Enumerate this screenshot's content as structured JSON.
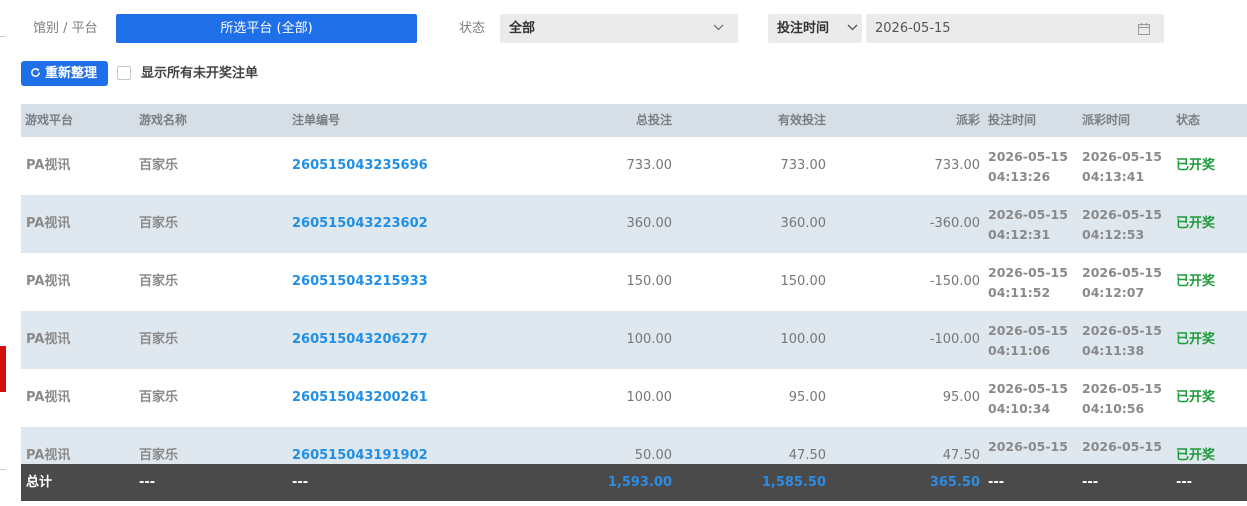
{
  "filters": {
    "platform_label": "馆别 / 平台",
    "platform_button": "所选平台 (全部)",
    "status_label": "状态",
    "status_value": "全部",
    "time_type_value": "投注时间",
    "date_value": "2026-05-15"
  },
  "actions": {
    "refresh_label": "重新整理",
    "show_unsettled_label": "显示所有未开奖注单",
    "show_unsettled_checked": false
  },
  "table": {
    "headers": {
      "platform": "游戏平台",
      "game": "游戏名称",
      "bet_id": "注单编号",
      "total_bet": "总投注",
      "valid_bet": "有效投注",
      "payout": "派彩",
      "bet_time": "投注时间",
      "payout_time": "派彩时间",
      "status": "状态"
    },
    "rows": [
      {
        "platform": "PA视讯",
        "game": "百家乐",
        "bet_id": "260515043235696",
        "total_bet": "733.00",
        "valid_bet": "733.00",
        "payout": "733.00",
        "bet_date": "2026-05-15",
        "bet_clock": "04:13:26",
        "pay_date": "2026-05-15",
        "pay_clock": "04:13:41",
        "status": "已开奖"
      },
      {
        "platform": "PA视讯",
        "game": "百家乐",
        "bet_id": "260515043223602",
        "total_bet": "360.00",
        "valid_bet": "360.00",
        "payout": "-360.00",
        "bet_date": "2026-05-15",
        "bet_clock": "04:12:31",
        "pay_date": "2026-05-15",
        "pay_clock": "04:12:53",
        "status": "已开奖"
      },
      {
        "platform": "PA视讯",
        "game": "百家乐",
        "bet_id": "260515043215933",
        "total_bet": "150.00",
        "valid_bet": "150.00",
        "payout": "-150.00",
        "bet_date": "2026-05-15",
        "bet_clock": "04:11:52",
        "pay_date": "2026-05-15",
        "pay_clock": "04:12:07",
        "status": "已开奖"
      },
      {
        "platform": "PA视讯",
        "game": "百家乐",
        "bet_id": "260515043206277",
        "total_bet": "100.00",
        "valid_bet": "100.00",
        "payout": "-100.00",
        "bet_date": "2026-05-15",
        "bet_clock": "04:11:06",
        "pay_date": "2026-05-15",
        "pay_clock": "04:11:38",
        "status": "已开奖"
      },
      {
        "platform": "PA视讯",
        "game": "百家乐",
        "bet_id": "260515043200261",
        "total_bet": "100.00",
        "valid_bet": "95.00",
        "payout": "95.00",
        "bet_date": "2026-05-15",
        "bet_clock": "04:10:34",
        "pay_date": "2026-05-15",
        "pay_clock": "04:10:56",
        "status": "已开奖"
      },
      {
        "platform": "PA视讯",
        "game": "百家乐",
        "bet_id": "260515043191902",
        "total_bet": "50.00",
        "valid_bet": "47.50",
        "payout": "47.50",
        "bet_date": "2026-05-15",
        "bet_clock": "",
        "pay_date": "2026-05-15",
        "pay_clock": "",
        "status": "已开奖"
      }
    ],
    "footer": {
      "label": "总计",
      "platform": "---",
      "game": "---",
      "total_bet": "1,593.00",
      "valid_bet": "1,585.50",
      "payout": "365.50",
      "bet_time": "---",
      "payout_time": "---",
      "status": "---"
    }
  },
  "colors": {
    "primary": "#1f6fe8",
    "link": "#1f8fe8",
    "status_settled": "#1e9b3a",
    "header_bg": "#d6dee6",
    "row_alt_bg": "#dfe7ef",
    "footer_bg": "#4a4a4a"
  },
  "icons": {
    "status_select": "chevron-down-icon",
    "time_type_select": "chevron-down-icon",
    "date_input": "calendar-icon",
    "refresh": "refresh-icon"
  }
}
